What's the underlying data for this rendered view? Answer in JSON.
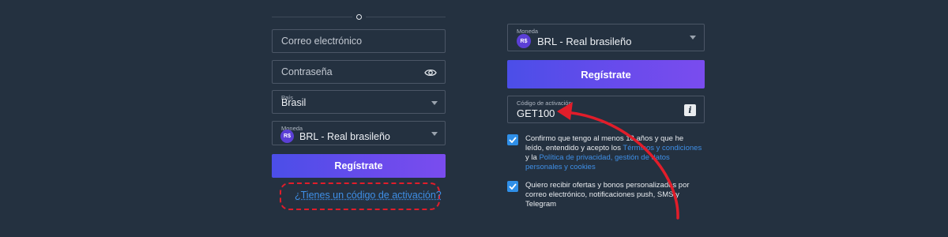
{
  "left": {
    "email_placeholder": "Correo electrónico",
    "password_placeholder": "Contraseña",
    "country_label": "País",
    "country_value": "Brasil",
    "currency_label": "Moneda",
    "currency_badge": "R$",
    "currency_value": "BRL - Real brasileño",
    "register_label": "Regístrate",
    "activation_link": "¿Tienes un código de activación?"
  },
  "right": {
    "currency_label": "Moneda",
    "currency_badge": "R$",
    "currency_value": "BRL - Real brasileño",
    "register_label": "Regístrate",
    "code_label": "Código de activación",
    "code_value": "GET100",
    "info_icon_text": "i",
    "terms": {
      "part1": "Confirmo que tengo al menos 18 años y que he leído, entendido y acepto los ",
      "link1": "Términos y condiciones",
      "part2": " y la ",
      "link2": "Política de privacidad, gestión de datos personales y cookies"
    },
    "offers_text": "Quiero recibir ofertas y bonos personalizados por correo electrónico, notificaciones push, SMS y Telegram"
  },
  "colors": {
    "background": "#243140",
    "accent_gradient_start": "#4b4ee8",
    "accent_gradient_end": "#7a4cee",
    "link": "#3f8fe6",
    "annotation_red": "#e11d2a",
    "checkbox": "#2f8fe8"
  },
  "icons": [
    "eye-icon",
    "chevron-down-icon",
    "info-icon",
    "checkmark-icon",
    "currency-badge",
    "red-arrow",
    "dashed-highlight"
  ]
}
